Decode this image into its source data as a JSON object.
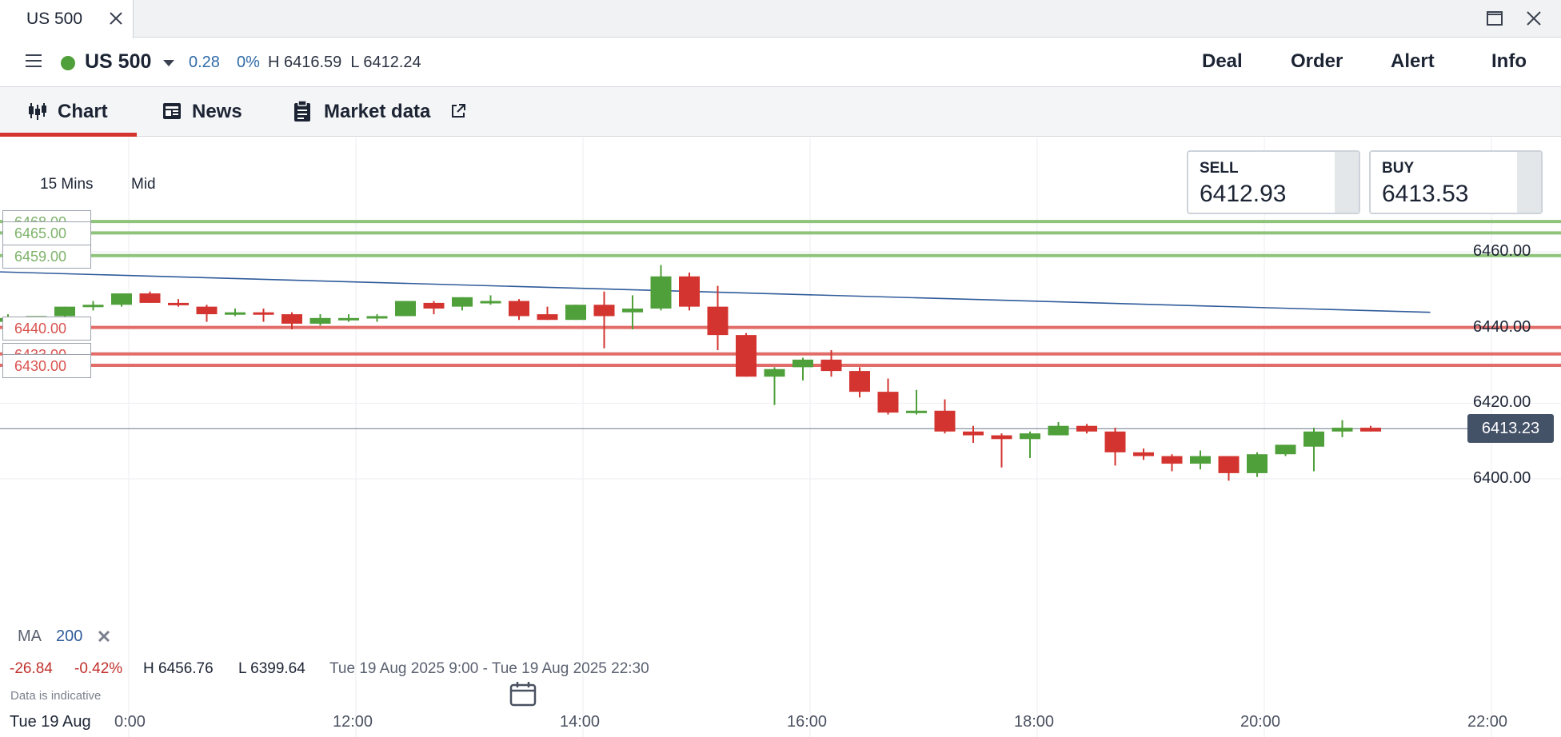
{
  "window": {
    "tab_title": "US 500"
  },
  "header": {
    "instrument": "US 500",
    "status_color": "#4f9f3a",
    "change_points": "0.28",
    "change_percent": "0%",
    "high_low": "H 6416.59  L 6412.24",
    "actions": [
      "Deal",
      "Order",
      "Alert",
      "Info"
    ]
  },
  "tabs": [
    {
      "label": "Chart",
      "icon": "candlestick-icon",
      "active": true
    },
    {
      "label": "News",
      "icon": "newspaper-icon",
      "active": false
    },
    {
      "label": "Market data",
      "icon": "clipboard-icon",
      "active": false
    }
  ],
  "chart": {
    "timeframe": "15 Mins",
    "price_type": "Mid",
    "sell": {
      "label": "SELL",
      "price": "6412.93"
    },
    "buy": {
      "label": "BUY",
      "price": "6413.53"
    },
    "indicator": {
      "label": "MA",
      "period": "200"
    },
    "stats": {
      "change_points": "-26.84",
      "change_percent": "-0.42%",
      "high": "H 6456.76",
      "low": "L 6399.64",
      "range": "Tue 19 Aug 2025 9:00 - Tue 19 Aug 2025 22:30"
    },
    "disclaimer": "Data is indicative",
    "x_date": "Tue 19 Aug",
    "colors": {
      "up": "#4f9f3a",
      "down": "#d3342f",
      "ma": "#2f5b9a",
      "last_price_bg": "#445268"
    }
  },
  "chart_data": {
    "type": "candlestick",
    "timeframe": "15 Mins",
    "y_ticks": [
      "6460.00",
      "6440.00",
      "6420.00",
      "6400.00"
    ],
    "x_ticks": [
      "0:00",
      "12:00",
      "14:00",
      "16:00",
      "18:00",
      "20:00",
      "22:00"
    ],
    "last_price": "6413.23",
    "levels": [
      {
        "value": 6468.0,
        "label": "6468.00",
        "kind": "green"
      },
      {
        "value": 6465.0,
        "label": "6465.00",
        "kind": "green"
      },
      {
        "value": 6459.0,
        "label": "6459.00",
        "kind": "green"
      },
      {
        "value": 6440.0,
        "label": "6440.00",
        "kind": "red"
      },
      {
        "value": 6433.0,
        "label": "6433.00",
        "kind": "red"
      },
      {
        "value": 6430.0,
        "label": "6430.00",
        "kind": "red"
      }
    ],
    "moving_average": {
      "period": 200,
      "start": [
        "9:00",
        6453.0
      ],
      "end": [
        "21:15",
        6444.0
      ]
    },
    "candles": [
      {
        "t": "9:00",
        "o": 6441.5,
        "h": 6443.5,
        "l": 6440.0,
        "c": 6442.5
      },
      {
        "t": "9:15",
        "o": 6442.5,
        "h": 6443.0,
        "l": 6442.0,
        "c": 6443.0
      },
      {
        "t": "9:30",
        "o": 6443.0,
        "h": 6445.5,
        "l": 6442.5,
        "c": 6445.5
      },
      {
        "t": "9:45",
        "o": 6445.5,
        "h": 6447.0,
        "l": 6444.5,
        "c": 6446.0
      },
      {
        "t": "10:00",
        "o": 6446.0,
        "h": 6449.0,
        "l": 6445.5,
        "c": 6449.0
      },
      {
        "t": "10:15",
        "o": 6449.0,
        "h": 6449.5,
        "l": 6446.5,
        "c": 6446.5
      },
      {
        "t": "10:30",
        "o": 6446.5,
        "h": 6447.5,
        "l": 6445.5,
        "c": 6446.0
      },
      {
        "t": "10:45",
        "o": 6445.5,
        "h": 6446.0,
        "l": 6441.5,
        "c": 6443.5
      },
      {
        "t": "11:00",
        "o": 6444.0,
        "h": 6445.0,
        "l": 6443.0,
        "c": 6444.0
      },
      {
        "t": "11:15",
        "o": 6444.0,
        "h": 6445.0,
        "l": 6441.5,
        "c": 6443.5
      },
      {
        "t": "11:30",
        "o": 6443.5,
        "h": 6444.0,
        "l": 6439.5,
        "c": 6441.0
      },
      {
        "t": "11:45",
        "o": 6441.0,
        "h": 6443.5,
        "l": 6440.5,
        "c": 6442.5
      },
      {
        "t": "12:00",
        "o": 6442.5,
        "h": 6443.5,
        "l": 6441.5,
        "c": 6442.5
      },
      {
        "t": "12:15",
        "o": 6442.5,
        "h": 6443.5,
        "l": 6441.5,
        "c": 6443.0
      },
      {
        "t": "12:30",
        "o": 6443.0,
        "h": 6447.0,
        "l": 6443.0,
        "c": 6447.0
      },
      {
        "t": "12:45",
        "o": 6446.5,
        "h": 6447.0,
        "l": 6443.5,
        "c": 6445.0
      },
      {
        "t": "13:00",
        "o": 6445.5,
        "h": 6448.0,
        "l": 6444.5,
        "c": 6448.0
      },
      {
        "t": "13:15",
        "o": 6447.0,
        "h": 6448.5,
        "l": 6446.0,
        "c": 6447.0
      },
      {
        "t": "13:30",
        "o": 6447.0,
        "h": 6447.5,
        "l": 6442.0,
        "c": 6443.0
      },
      {
        "t": "13:45",
        "o": 6443.5,
        "h": 6445.5,
        "l": 6442.0,
        "c": 6442.0
      },
      {
        "t": "14:00",
        "o": 6442.0,
        "h": 6446.0,
        "l": 6442.0,
        "c": 6446.0
      },
      {
        "t": "14:15",
        "o": 6446.0,
        "h": 6449.5,
        "l": 6434.5,
        "c": 6443.0
      },
      {
        "t": "14:30",
        "o": 6444.0,
        "h": 6448.5,
        "l": 6439.5,
        "c": 6445.0
      },
      {
        "t": "14:45",
        "o": 6445.0,
        "h": 6456.5,
        "l": 6444.5,
        "c": 6453.5
      },
      {
        "t": "15:00",
        "o": 6453.5,
        "h": 6454.5,
        "l": 6444.5,
        "c": 6445.5
      },
      {
        "t": "15:15",
        "o": 6445.5,
        "h": 6451.0,
        "l": 6434.0,
        "c": 6438.0
      },
      {
        "t": "15:30",
        "o": 6438.0,
        "h": 6438.5,
        "l": 6427.0,
        "c": 6427.0
      },
      {
        "t": "15:45",
        "o": 6427.0,
        "h": 6429.5,
        "l": 6419.5,
        "c": 6429.0
      },
      {
        "t": "16:00",
        "o": 6429.5,
        "h": 6432.0,
        "l": 6426.0,
        "c": 6431.5
      },
      {
        "t": "16:15",
        "o": 6431.5,
        "h": 6434.0,
        "l": 6427.0,
        "c": 6428.5
      },
      {
        "t": "16:30",
        "o": 6428.5,
        "h": 6429.5,
        "l": 6421.5,
        "c": 6423.0
      },
      {
        "t": "16:45",
        "o": 6423.0,
        "h": 6426.5,
        "l": 6417.0,
        "c": 6417.5
      },
      {
        "t": "17:00",
        "o": 6417.5,
        "h": 6423.5,
        "l": 6417.0,
        "c": 6418.0
      },
      {
        "t": "17:15",
        "o": 6418.0,
        "h": 6421.0,
        "l": 6412.0,
        "c": 6412.5
      },
      {
        "t": "17:30",
        "o": 6412.5,
        "h": 6414.0,
        "l": 6409.5,
        "c": 6411.5
      },
      {
        "t": "17:45",
        "o": 6411.5,
        "h": 6412.0,
        "l": 6403.0,
        "c": 6410.5
      },
      {
        "t": "18:00",
        "o": 6410.5,
        "h": 6412.5,
        "l": 6405.5,
        "c": 6412.0
      },
      {
        "t": "18:15",
        "o": 6411.5,
        "h": 6415.0,
        "l": 6411.5,
        "c": 6414.0
      },
      {
        "t": "18:30",
        "o": 6414.0,
        "h": 6414.5,
        "l": 6412.0,
        "c": 6412.5
      },
      {
        "t": "18:45",
        "o": 6412.5,
        "h": 6413.5,
        "l": 6403.5,
        "c": 6407.0
      },
      {
        "t": "19:00",
        "o": 6407.0,
        "h": 6408.0,
        "l": 6405.0,
        "c": 6406.0
      },
      {
        "t": "19:15",
        "o": 6406.0,
        "h": 6406.5,
        "l": 6402.0,
        "c": 6404.0
      },
      {
        "t": "19:30",
        "o": 6404.0,
        "h": 6407.5,
        "l": 6402.5,
        "c": 6406.0
      },
      {
        "t": "19:45",
        "o": 6406.0,
        "h": 6406.0,
        "l": 6399.5,
        "c": 6401.5
      },
      {
        "t": "20:00",
        "o": 6401.5,
        "h": 6407.0,
        "l": 6400.5,
        "c": 6406.5
      },
      {
        "t": "20:15",
        "o": 6406.5,
        "h": 6409.0,
        "l": 6406.0,
        "c": 6409.0
      },
      {
        "t": "20:30",
        "o": 6408.5,
        "h": 6413.5,
        "l": 6402.0,
        "c": 6412.5
      },
      {
        "t": "20:45",
        "o": 6412.5,
        "h": 6415.5,
        "l": 6411.0,
        "c": 6413.5
      },
      {
        "t": "21:00",
        "o": 6413.5,
        "h": 6414.0,
        "l": 6412.5,
        "c": 6412.5
      }
    ]
  }
}
